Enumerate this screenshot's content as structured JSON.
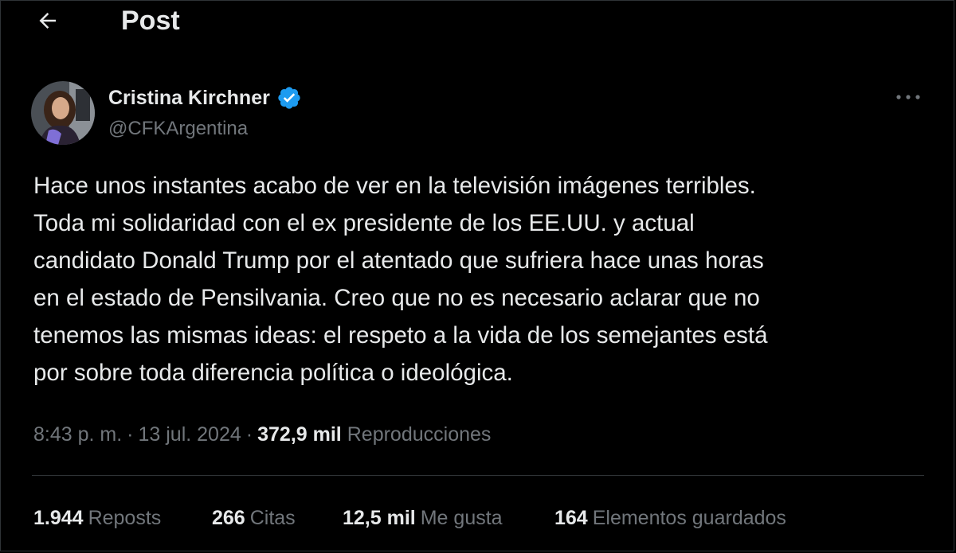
{
  "header": {
    "title": "Post",
    "back_icon": "arrow-left-icon"
  },
  "author": {
    "name": "Cristina Kirchner",
    "handle": "@CFKArgentina",
    "verified": true,
    "verified_color": "#1d9bf0"
  },
  "post": {
    "text": "Hace unos instantes acabo de ver en la televisión imágenes terribles.\nToda mi solidaridad con el ex presidente de los EE.UU. y actual\ncandidato Donald Trump por el atentado que sufriera hace unas horas\nen el estado de Pensilvania. Creo que no es necesario aclarar que no\ntenemos las mismas ideas: el respeto a la vida de los semejantes está\npor sobre toda diferencia política o ideológica."
  },
  "meta": {
    "time": "8:43 p. m.",
    "separator": "·",
    "date": "13 jul. 2024",
    "views_count": "372,9 mil",
    "views_label": "Reproducciones"
  },
  "stats": {
    "reposts_count": "1.944",
    "reposts_label": "Reposts",
    "quotes_count": "266",
    "quotes_label": "Citas",
    "likes_count": "12,5 mil",
    "likes_label": "Me gusta",
    "bookmarks_count": "164",
    "bookmarks_label": "Elementos guardados"
  },
  "colors": {
    "background": "#000000",
    "text_primary": "#e7e9ea",
    "text_secondary": "#71767b",
    "divider": "#2f3336",
    "accent": "#1d9bf0"
  }
}
